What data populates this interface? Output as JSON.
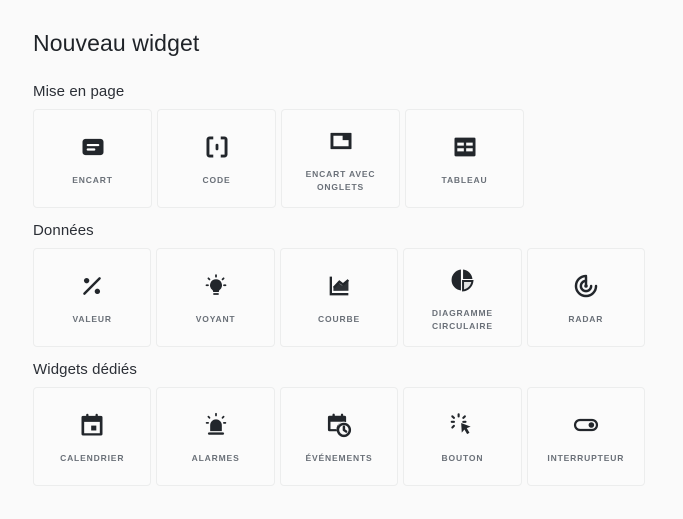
{
  "page": {
    "title": "Nouveau widget",
    "background_color": "#fafafa",
    "card_border_color": "#eceded",
    "label_color": "#6a7078",
    "icon_color": "#22262b"
  },
  "sections": [
    {
      "title": "Mise en page",
      "cards": [
        {
          "label": "ENCART",
          "icon": "panel-icon"
        },
        {
          "label": "CODE",
          "icon": "brackets-icon"
        },
        {
          "label": "ENCART AVEC ONGLETS",
          "icon": "tabbed-panel-icon"
        },
        {
          "label": "TABLEAU",
          "icon": "table-grid-icon"
        }
      ]
    },
    {
      "title": "Données",
      "cards": [
        {
          "label": "VALEUR",
          "icon": "percent-icon"
        },
        {
          "label": "VOYANT",
          "icon": "lightbulb-icon"
        },
        {
          "label": "COURBE",
          "icon": "line-chart-icon"
        },
        {
          "label": "DIAGRAMME CIRCULAIRE",
          "icon": "pie-chart-icon"
        },
        {
          "label": "RADAR",
          "icon": "radar-icon"
        }
      ]
    },
    {
      "title": "Widgets dédiés",
      "cards": [
        {
          "label": "CALENDRIER",
          "icon": "calendar-icon"
        },
        {
          "label": "ALARMES",
          "icon": "alarm-siren-icon"
        },
        {
          "label": "ÉVÉNEMENTS",
          "icon": "calendar-clock-icon"
        },
        {
          "label": "BOUTON",
          "icon": "click-cursor-icon"
        },
        {
          "label": "INTERRUPTEUR",
          "icon": "toggle-switch-icon"
        }
      ]
    }
  ]
}
